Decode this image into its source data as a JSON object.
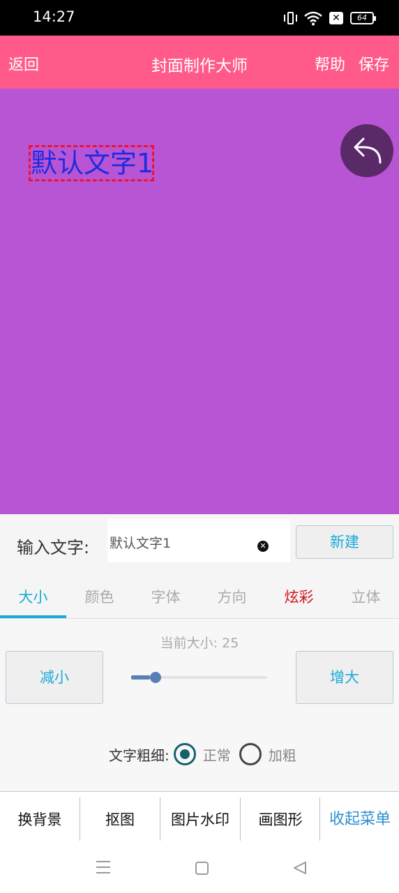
{
  "status_bar": {
    "time": "14:27",
    "battery": "64",
    "icons": [
      "vibrate-icon",
      "wifi-icon",
      "sim-blocked-icon",
      "battery-icon"
    ]
  },
  "titlebar": {
    "back_label": "返回",
    "title": "封面制作大师",
    "help_label": "帮助",
    "save_label": "保存",
    "color": "#ff5a8a"
  },
  "canvas": {
    "background": "#b855d4",
    "text_item": "默认文字1",
    "text_color": "#1f2be0",
    "undo_icon": "undo-arrow-icon"
  },
  "input_row": {
    "label": "输入文字:",
    "value": "默认文字1",
    "new_button": "新建"
  },
  "tabs": {
    "items": [
      "大小",
      "颜色",
      "字体",
      "方向",
      "炫彩",
      "立体"
    ],
    "active": "大小"
  },
  "size_panel": {
    "current_label": "当前大小:",
    "current_value": "25",
    "decrease_button": "减小",
    "increase_button": "增大",
    "slider_fraction": 0.14,
    "weight_label": "文字粗细:",
    "weight_options": [
      "正常",
      "加粗"
    ],
    "weight_selected": "正常"
  },
  "bottom_menu": {
    "items": [
      "换背景",
      "抠图",
      "图片水印",
      "画图形",
      "收起菜单"
    ]
  },
  "nav_bar": {
    "icons": [
      "menu-icon",
      "home-icon",
      "back-icon"
    ]
  }
}
